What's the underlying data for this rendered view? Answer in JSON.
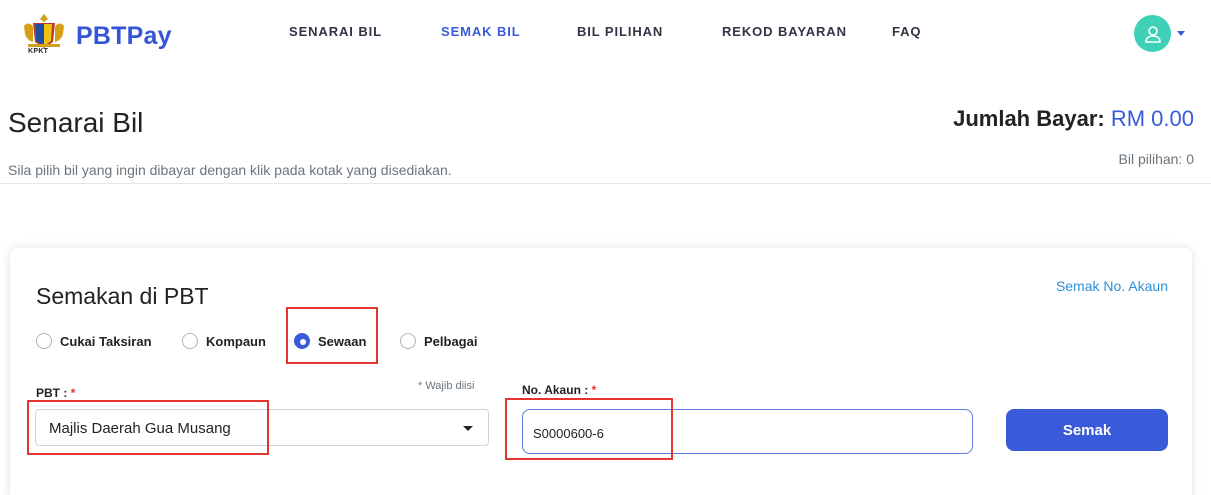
{
  "brand": {
    "name": "PBTPay",
    "crest_caption": "KPKT"
  },
  "nav": {
    "items": [
      {
        "label": "SENARAI BIL"
      },
      {
        "label": "SEMAK BIL"
      },
      {
        "label": "BIL PILIHAN"
      },
      {
        "label": "REKOD BAYARAN"
      },
      {
        "label": "FAQ"
      }
    ],
    "active": "SEMAK BIL"
  },
  "header": {
    "title": "Senarai Bil",
    "subtitle": "Sila pilih bil yang ingin dibayar dengan klik pada kotak yang disediakan.",
    "total_label": "Jumlah Bayar:",
    "total_amount": "RM 0.00",
    "selected_label": "Bil pilihan: 0"
  },
  "card": {
    "title": "Semakan di PBT",
    "lookup_link": "Semak No. Akaun",
    "radio_options": [
      {
        "label": "Cukai Taksiran",
        "checked": false
      },
      {
        "label": "Kompaun",
        "checked": false
      },
      {
        "label": "Sewaan",
        "checked": true
      },
      {
        "label": "Pelbagai",
        "checked": false
      }
    ],
    "pbt_label": "PBT :",
    "required_mark": "*",
    "required_hint": "* Wajib diisi",
    "pbt_selected": "Majlis Daerah Gua Musang",
    "account_label": "No. Akaun :",
    "account_value": "S0000600-6",
    "submit_label": "Semak"
  },
  "colors": {
    "brand": "#3355d6",
    "accent": "#3a5bd9",
    "avatar": "#3ed1b8",
    "link": "#2d8fd5",
    "highlight": "#e3342f"
  },
  "icons": {
    "avatar": "user-icon",
    "dropdown": "chevron-down-icon",
    "logo": "crest-icon"
  }
}
